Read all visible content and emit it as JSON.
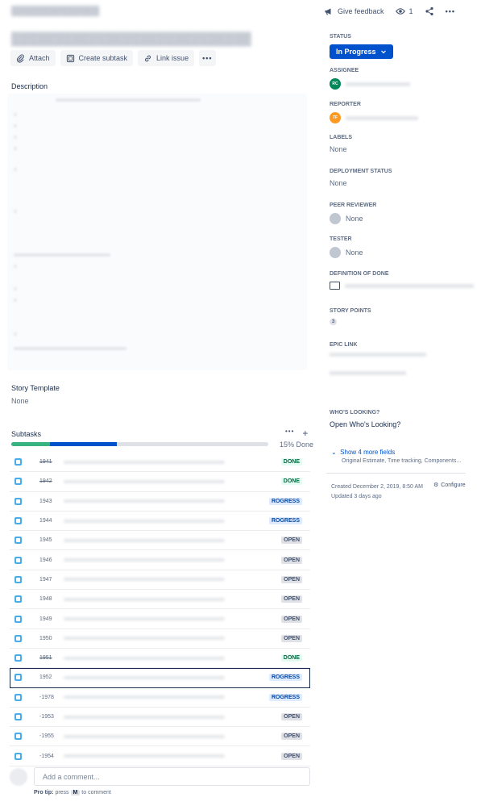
{
  "header": {
    "give_feedback": "Give feedback",
    "watch_count": "1"
  },
  "actions": {
    "attach": "Attach",
    "create_subtask": "Create subtask",
    "link_issue": "Link issue",
    "more": "•••"
  },
  "description": {
    "heading": "Description"
  },
  "story_template": {
    "heading": "Story Template",
    "value": "None"
  },
  "subtasks": {
    "heading": "Subtasks",
    "more": "•••",
    "add": "+",
    "progress_label": "15% Done",
    "progress": {
      "done_fraction": 0.15,
      "in_progress_fraction": 0.26
    },
    "items": [
      {
        "key": "1941",
        "status": "DONE",
        "kind": "done",
        "strike": true
      },
      {
        "key": "1942",
        "status": "DONE",
        "kind": "done",
        "strike": true
      },
      {
        "key": "1943",
        "status": "ROGRESS",
        "kind": "inprogress",
        "strike": false
      },
      {
        "key": "1944",
        "status": "ROGRESS",
        "kind": "inprogress",
        "strike": false
      },
      {
        "key": "1945",
        "status": "OPEN",
        "kind": "open",
        "strike": false
      },
      {
        "key": "1946",
        "status": "OPEN",
        "kind": "open",
        "strike": false
      },
      {
        "key": "1947",
        "status": "OPEN",
        "kind": "open",
        "strike": false
      },
      {
        "key": "1948",
        "status": "OPEN",
        "kind": "open",
        "strike": false
      },
      {
        "key": "1949",
        "status": "OPEN",
        "kind": "open",
        "strike": false
      },
      {
        "key": "1950",
        "status": "OPEN",
        "kind": "open",
        "strike": false
      },
      {
        "key": "1951",
        "status": "DONE",
        "kind": "done",
        "strike": true
      },
      {
        "key": "1952",
        "status": "ROGRESS",
        "kind": "inprogress",
        "strike": false
      },
      {
        "key": "-1978",
        "status": "ROGRESS",
        "kind": "inprogress",
        "strike": false
      },
      {
        "key": "-1953",
        "status": "OPEN",
        "kind": "open",
        "strike": false
      },
      {
        "key": "-1955",
        "status": "OPEN",
        "kind": "open",
        "strike": false
      },
      {
        "key": "-1954",
        "status": "OPEN",
        "kind": "open",
        "strike": false
      }
    ]
  },
  "comment": {
    "placeholder": "Add a comment...",
    "protip_bold": "Pro tip:",
    "protip_text": " press ",
    "protip_key": "M",
    "protip_end": " to comment"
  },
  "sidebar": {
    "status_label": "STATUS",
    "status_value": "In Progress",
    "assignee_label": "ASSIGNEE",
    "assignee_initials": "RC",
    "reporter_label": "REPORTER",
    "reporter_initials": "TF",
    "labels_label": "LABELS",
    "labels_value": "None",
    "deployment_label": "DEPLOYMENT STATUS",
    "deployment_value": "None",
    "peer_label": "PEER REVIEWER",
    "peer_value": "None",
    "tester_label": "TESTER",
    "tester_value": "None",
    "dod_label": "DEFINITION OF DONE",
    "story_points_label": "STORY POINTS",
    "story_points_value": "3",
    "epic_label": "EPIC LINK",
    "whos_looking_label": "WHO'S LOOKING?",
    "whos_looking_link": "Open Who's Looking?",
    "show_more": "Show 4 more fields",
    "show_more_sub": "Original Estimate, Time tracking, Components...",
    "created": "Created December 2, 2019, 8:50 AM",
    "updated": "Updated 3 days ago",
    "configure": "Configure"
  },
  "colors": {
    "primary": "#0052cc",
    "done_green": "#36b37e",
    "text": "#172b4d"
  }
}
